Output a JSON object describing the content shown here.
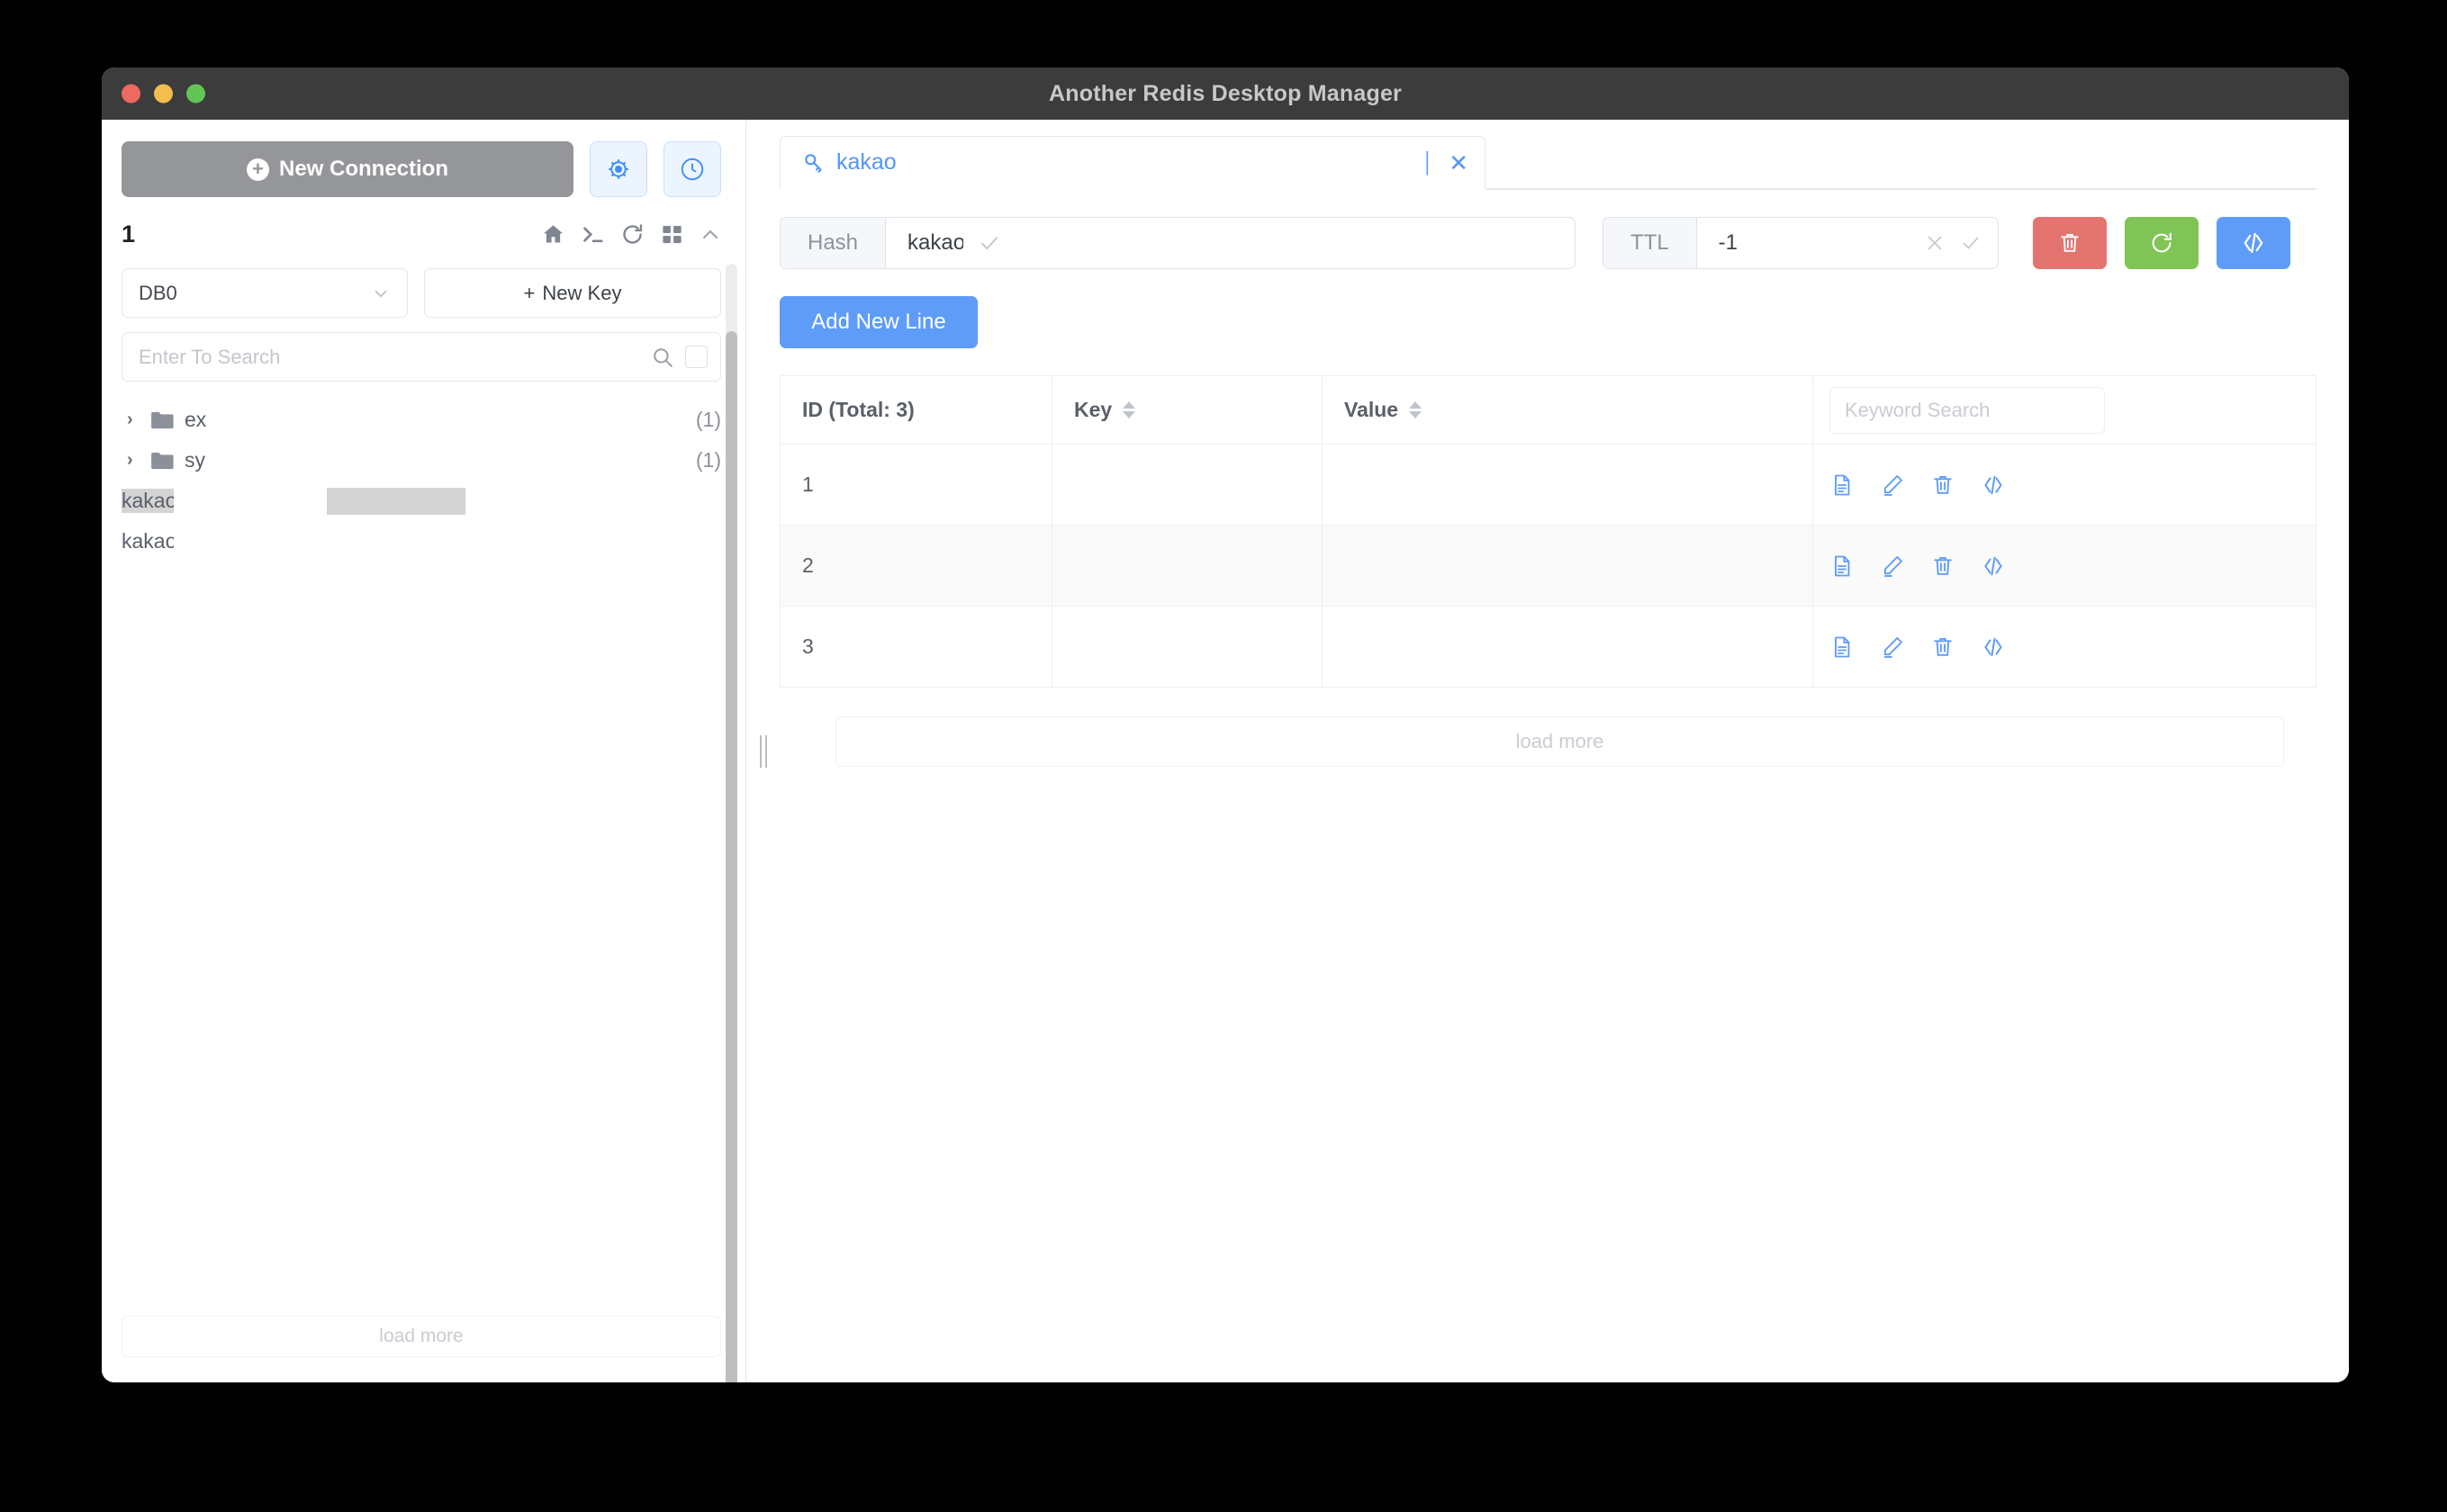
{
  "window": {
    "title": "Another Redis Desktop Manager",
    "traffic_lights": [
      "close-red",
      "minimize-yellow",
      "maximize-green"
    ]
  },
  "sidebar": {
    "new_connection_label": "New Connection",
    "new_connection_icon": "plus-circle-icon",
    "settings_button_icon": "gear-icon",
    "history_button_icon": "clock-icon",
    "connection_name": "1",
    "tools": [
      {
        "name": "home-icon",
        "glyph": "home"
      },
      {
        "name": "terminal-icon",
        "glyph": "terminal"
      },
      {
        "name": "refresh-icon",
        "glyph": "refresh"
      },
      {
        "name": "grid-icon",
        "glyph": "grid"
      },
      {
        "name": "chevron-up-icon",
        "glyph": "chevron-up"
      }
    ],
    "db_select": {
      "value": "DB0",
      "icon": "chevron-down-icon"
    },
    "new_key_label": "New Key",
    "new_key_icon": "plus-icon",
    "search": {
      "placeholder": "Enter To Search",
      "value": "",
      "icon": "search-icon",
      "checkbox": "regex-checkbox"
    },
    "tree": [
      {
        "type": "folder",
        "label": "ex",
        "count": "(1)",
        "expanded": false,
        "selected": false
      },
      {
        "type": "folder",
        "label": "sy",
        "count": "(1)",
        "expanded": false,
        "selected": false
      },
      {
        "type": "key",
        "label": "kakaov",
        "count": "",
        "selected": true
      },
      {
        "type": "key",
        "label": "kakaov",
        "count": "",
        "selected": false
      }
    ],
    "load_more_label": "load more",
    "scrollbar": "sidebar-scrollbar"
  },
  "main": {
    "tab": {
      "label": "kakao",
      "icon": "key-icon",
      "pin_icon": "pin-icon",
      "close_icon": "close-icon"
    },
    "key_toolbar": {
      "type_label": "Hash",
      "key_value": "kakao",
      "key_confirm_icon": "check-icon",
      "ttl_label": "TTL",
      "ttl_value": "-1",
      "ttl_clear_icon": "close-icon",
      "ttl_confirm_icon": "check-icon",
      "delete_button_icon": "trash-icon",
      "refresh_button_icon": "refresh-icon",
      "code_button_icon": "code-icon",
      "colors": {
        "delete": "#e47470",
        "refresh": "#80c456",
        "code": "#5e9cf8",
        "primary": "#5e9cf8"
      }
    },
    "add_new_line_label": "Add New Line",
    "table": {
      "columns": [
        "ID (Total: 3)",
        "Key",
        "Value",
        ""
      ],
      "keyword_search_placeholder": "Keyword Search",
      "keyword_search_value": "",
      "row_action_icons": [
        "document-icon",
        "edit-icon",
        "trash-icon",
        "code-icon"
      ],
      "rows": [
        {
          "id": "1",
          "key": "",
          "value": ""
        },
        {
          "id": "2",
          "key": "",
          "value": ""
        },
        {
          "id": "3",
          "key": "",
          "value": ""
        }
      ]
    },
    "load_more_label": "load more"
  }
}
